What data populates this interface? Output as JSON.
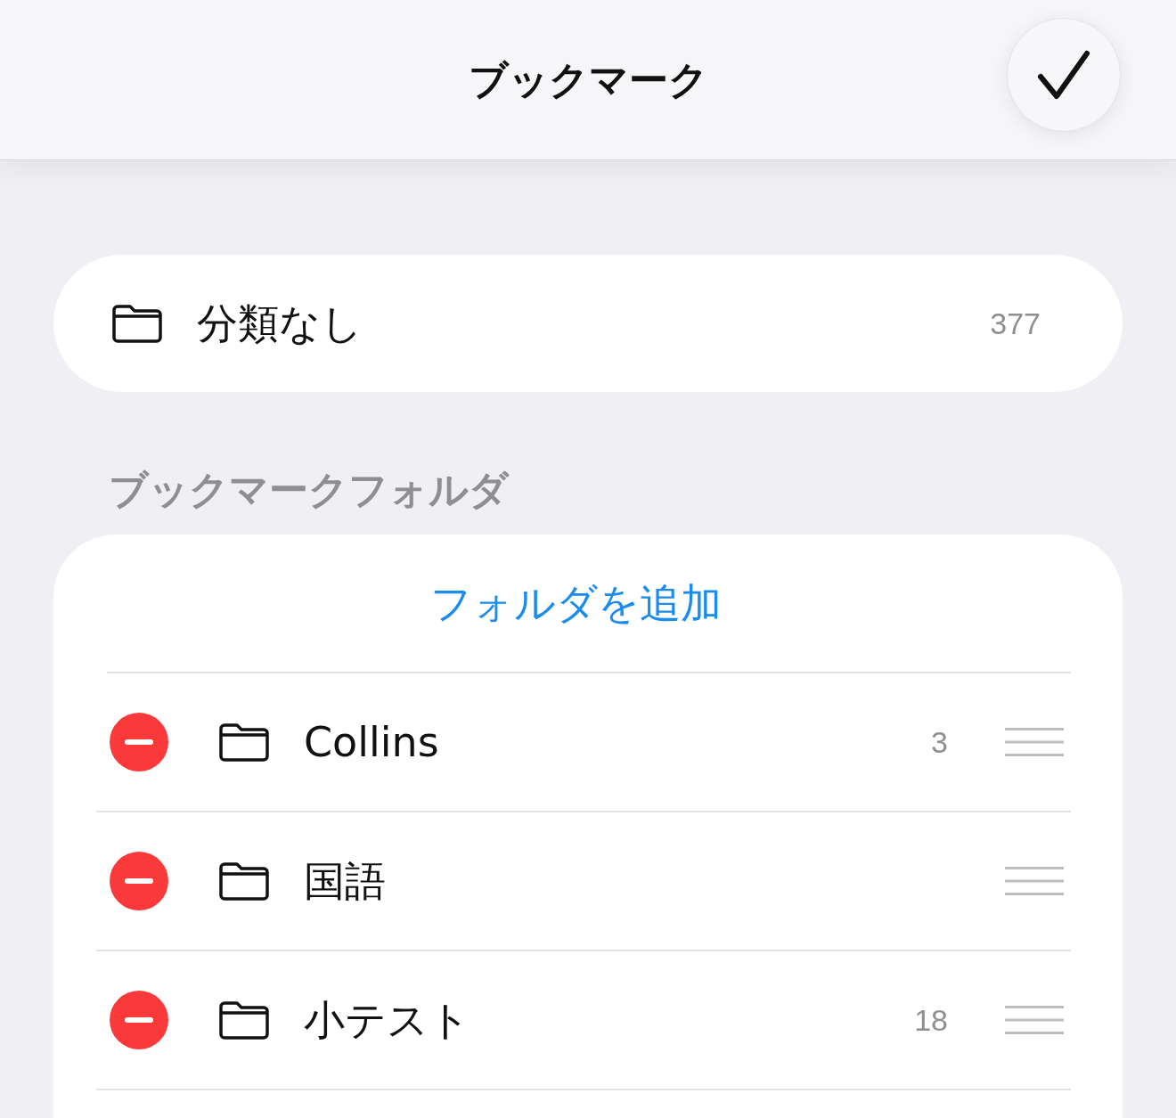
{
  "header": {
    "title": "ブックマーク"
  },
  "uncategorized": {
    "label": "分類なし",
    "count": "377"
  },
  "section_header": "ブックマークフォルダ",
  "add_folder_button": "フォルダを追加",
  "folders": [
    {
      "name": "Collins",
      "count": "3"
    },
    {
      "name": "国語"
    },
    {
      "name": "小テスト",
      "count": "18"
    }
  ]
}
